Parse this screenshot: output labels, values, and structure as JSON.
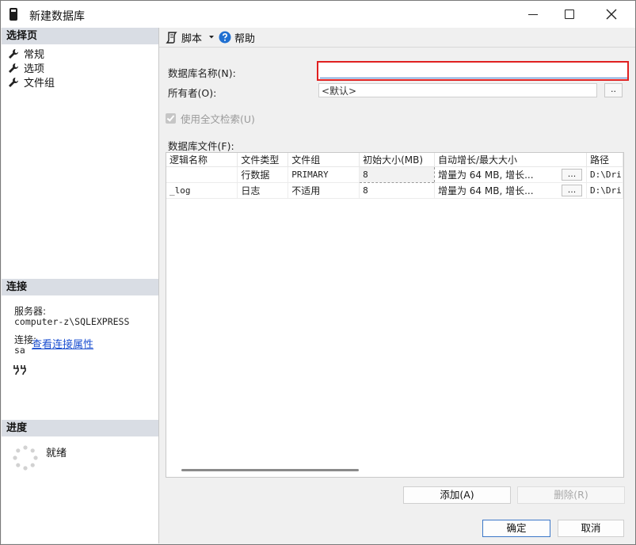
{
  "window": {
    "title": "新建数据库"
  },
  "left": {
    "select_page_header": "选择页",
    "pages": [
      "常规",
      "选项",
      "文件组"
    ],
    "connection_header": "连接",
    "server_label": "服务器:",
    "server_value": "computer-z\\SQLEXPRESS",
    "connection_label": "连接:",
    "connection_value": "sa",
    "view_props_link": "查看连接属性",
    "progress_header": "进度",
    "progress_status": "就绪"
  },
  "toolbar": {
    "script_label": "脚本",
    "help_label": "帮助"
  },
  "form": {
    "db_name_label": "数据库名称(N):",
    "db_name_value": "",
    "owner_label": "所有者(O):",
    "owner_value": "<默认>",
    "owner_browse": "..",
    "fulltext_label": "使用全文检索(U)",
    "files_label": "数据库文件(F):"
  },
  "files_table": {
    "columns": [
      "逻辑名称",
      "文件类型",
      "文件组",
      "初始大小(MB)",
      "自动增长/最大大小",
      "路径"
    ],
    "rows": [
      {
        "logical_name": "",
        "file_type": "行数据",
        "filegroup": "PRIMARY",
        "initial_size": "8",
        "autogrowth": "增量为 64 MB, 增长...",
        "browse": "...",
        "path": "D:\\Dri"
      },
      {
        "logical_name": "_log",
        "file_type": "日志",
        "filegroup": "不适用",
        "initial_size": "8",
        "autogrowth": "增量为 64 MB, 增长...",
        "browse": "...",
        "path": "D:\\Dri"
      }
    ]
  },
  "buttons": {
    "add": "添加(A)",
    "remove": "删除(R)",
    "ok": "确定",
    "cancel": "取消"
  },
  "colors": {
    "highlight_border": "#e02020",
    "link": "#1b4fd0",
    "section_header_bg": "#d9dde4"
  }
}
